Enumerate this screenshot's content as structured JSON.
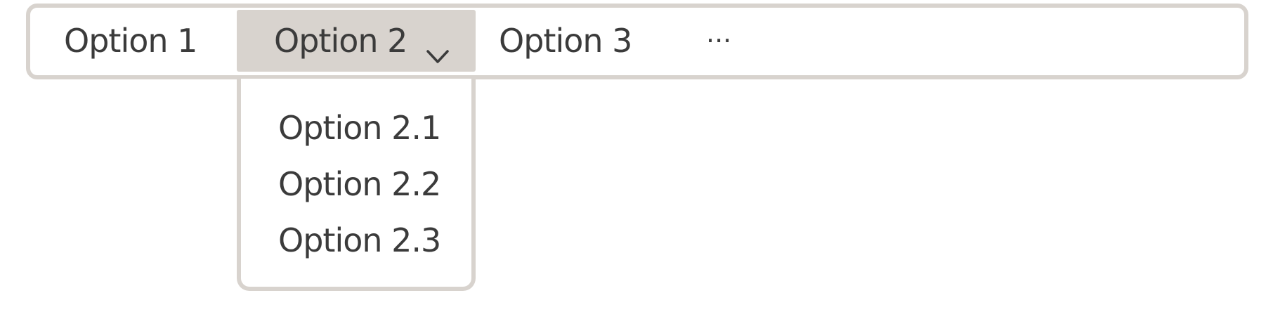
{
  "menubar": {
    "items": [
      {
        "label": "Option 1"
      },
      {
        "label": "Option 2",
        "expanded": true,
        "has_submenu": true
      },
      {
        "label": "Option 3"
      },
      {
        "label": "···"
      }
    ]
  },
  "submenu": {
    "items": [
      {
        "label": "Option 2.1"
      },
      {
        "label": "Option 2.2"
      },
      {
        "label": "Option 2.3"
      }
    ]
  },
  "colors": {
    "border": "#d8d3ce",
    "active_background": "#d8d3ce",
    "text": "#3b3b3b",
    "background": "#ffffff"
  },
  "icons": {
    "submenu_indicator": "chevron-down-icon"
  }
}
